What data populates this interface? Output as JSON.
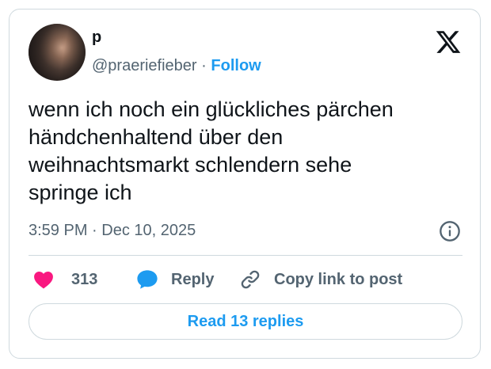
{
  "author": {
    "display_name": "p",
    "handle": "@praeriefieber",
    "separator": "·",
    "follow_label": "Follow",
    "avatar_icon": "profile-photo"
  },
  "tweet": {
    "text": "wenn ich noch ein glückliches pärchen\nhändchenhaltend über den\nweihnachtsmarkt schlendern sehe\nspringe ich",
    "time": "3:59 PM",
    "separator": "·",
    "date": "Dec 10, 2025"
  },
  "actions": {
    "like_count": "313",
    "reply_label": "Reply",
    "copy_label": "Copy link to post"
  },
  "footer": {
    "read_replies_label": "Read 13 replies"
  },
  "colors": {
    "accent": "#1d9bf0",
    "like": "#f91880",
    "text": "#0f1419",
    "muted": "#536471",
    "border": "#cfd9de"
  },
  "icons": [
    "x-logo-icon",
    "info-icon",
    "heart-icon",
    "reply-bubble-icon",
    "link-icon"
  ]
}
